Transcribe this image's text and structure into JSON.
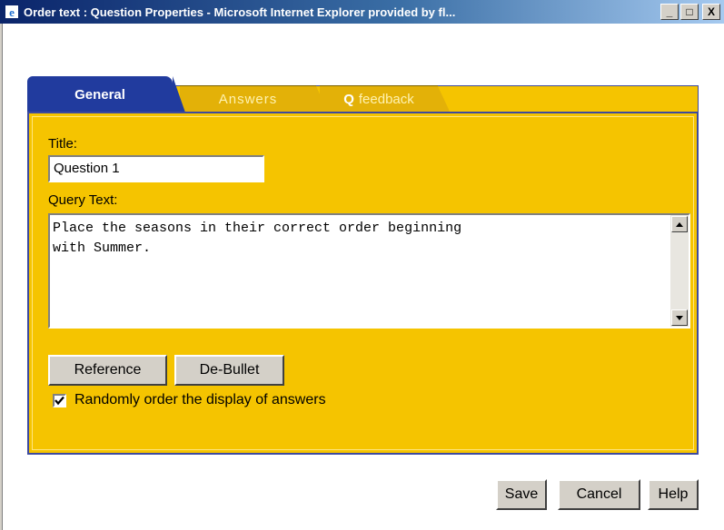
{
  "window": {
    "title": "Order text : Question Properties - Microsoft Internet Explorer provided by fl...",
    "minimize": "_",
    "maximize": "□",
    "close": "X"
  },
  "tabs": {
    "general": "General",
    "answers": "Answers",
    "feedback_prefix": "Q",
    "feedback": "feedback"
  },
  "form": {
    "title_label": "Title:",
    "title_value": "Question 1",
    "query_label": "Query Text:",
    "query_value": "Place the seasons in their correct order beginning\nwith Summer.",
    "reference_button": "Reference",
    "debullet_button": "De-Bullet",
    "random_order_label": "Randomly order the display of answers",
    "random_order_checked": true
  },
  "footer": {
    "save": "Save",
    "cancel": "Cancel",
    "help": "Help"
  },
  "colors": {
    "panel": "#f5c400",
    "active_tab": "#213b9e",
    "inactive_tab": "#e3b108"
  }
}
